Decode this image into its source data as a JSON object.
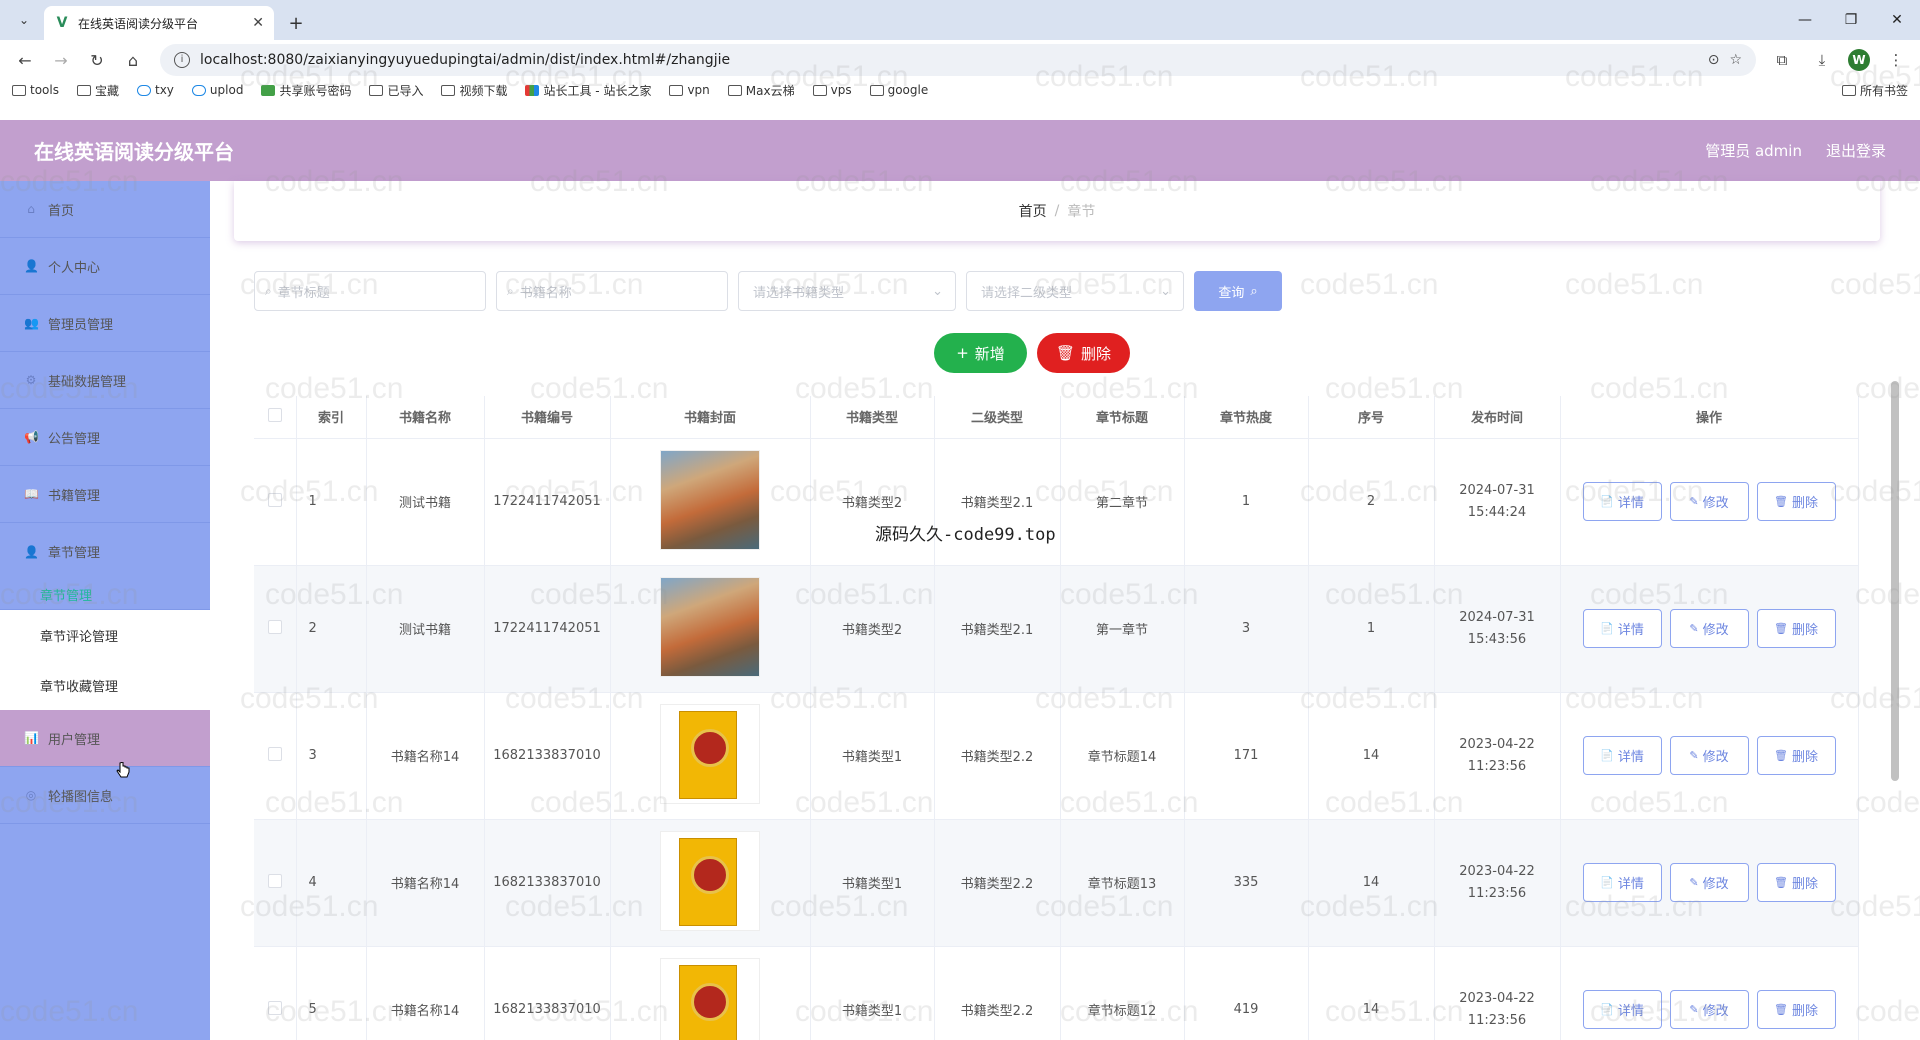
{
  "browser": {
    "tab_title": "在线英语阅读分级平台",
    "url": "localhost:8080/zaixianyingyuyuedupingtai/admin/dist/index.html#/zhangjie",
    "bookmarks": [
      {
        "label": "tools",
        "icon": "folder"
      },
      {
        "label": "宝藏",
        "icon": "folder"
      },
      {
        "label": "txy",
        "icon": "cloud"
      },
      {
        "label": "uplod",
        "icon": "cloud"
      },
      {
        "label": "共享账号密码",
        "icon": "green"
      },
      {
        "label": "已导入",
        "icon": "folder"
      },
      {
        "label": "视频下载",
        "icon": "folder"
      },
      {
        "label": "站长工具 - 站长之家",
        "icon": "multi"
      },
      {
        "label": "vpn",
        "icon": "folder"
      },
      {
        "label": "Max云梯",
        "icon": "folder"
      },
      {
        "label": "vps",
        "icon": "folder"
      },
      {
        "label": "google",
        "icon": "folder"
      }
    ],
    "all_bookmarks": "所有书签",
    "profile_initial": "W"
  },
  "app": {
    "title": "在线英语阅读分级平台",
    "user_label": "管理员 admin",
    "logout": "退出登录",
    "colors": {
      "header": "#c29fce",
      "sidebar": "#8ea5f0",
      "add": "#23b14d",
      "delete": "#e02020",
      "active_sub": "#1fb89a"
    }
  },
  "sidebar": {
    "items": [
      {
        "label": "首页"
      },
      {
        "label": "个人中心"
      },
      {
        "label": "管理员管理"
      },
      {
        "label": "基础数据管理"
      },
      {
        "label": "公告管理"
      },
      {
        "label": "书籍管理"
      },
      {
        "label": "章节管理"
      }
    ],
    "sub_active": "章节管理",
    "sub_items": [
      "章节评论管理",
      "章节收藏管理"
    ],
    "after_items": [
      {
        "label": "用户管理"
      },
      {
        "label": "轮播图信息"
      }
    ]
  },
  "breadcrumb": {
    "home": "首页",
    "sep": "/",
    "current": "章节"
  },
  "search": {
    "chapter_title_placeholder": "章节标题",
    "book_name_placeholder": "书籍名称",
    "book_type_placeholder": "请选择书籍类型",
    "sub_type_placeholder": "请选择二级类型",
    "query_label": "查询"
  },
  "actions": {
    "add_label": "新增",
    "delete_label": "删除"
  },
  "table": {
    "headers": [
      "索引",
      "书籍名称",
      "书籍编号",
      "书籍封面",
      "书籍类型",
      "二级类型",
      "章节标题",
      "章节热度",
      "序号",
      "发布时间",
      "操作"
    ],
    "op_labels": {
      "detail": "详情",
      "edit": "修改",
      "delete": "删除"
    },
    "rows": [
      {
        "index": "1",
        "name": "测试书籍",
        "code": "1722411742051",
        "cover": "landscape",
        "type": "书籍类型2",
        "sub": "书籍类型2.1",
        "title": "第二章节",
        "heat": "1",
        "order": "2",
        "time": "2024-07-31 15:44:24"
      },
      {
        "index": "2",
        "name": "测试书籍",
        "code": "1722411742051",
        "cover": "landscape",
        "type": "书籍类型2",
        "sub": "书籍类型2.1",
        "title": "第一章节",
        "heat": "3",
        "order": "1",
        "time": "2024-07-31 15:43:56"
      },
      {
        "index": "3",
        "name": "书籍名称14",
        "code": "1682133837010",
        "cover": "book",
        "type": "书籍类型1",
        "sub": "书籍类型2.2",
        "title": "章节标题14",
        "heat": "171",
        "order": "14",
        "time": "2023-04-22 11:23:56"
      },
      {
        "index": "4",
        "name": "书籍名称14",
        "code": "1682133837010",
        "cover": "book",
        "type": "书籍类型1",
        "sub": "书籍类型2.2",
        "title": "章节标题13",
        "heat": "335",
        "order": "14",
        "time": "2023-04-22 11:23:56"
      },
      {
        "index": "5",
        "name": "书籍名称14",
        "code": "1682133837010",
        "cover": "book",
        "type": "书籍类型1",
        "sub": "书籍类型2.2",
        "title": "章节标题12",
        "heat": "419",
        "order": "14",
        "time": "2023-04-22 11:23:56"
      }
    ]
  },
  "overlay": "源码久久-code99.top",
  "watermark": "code51.cn"
}
